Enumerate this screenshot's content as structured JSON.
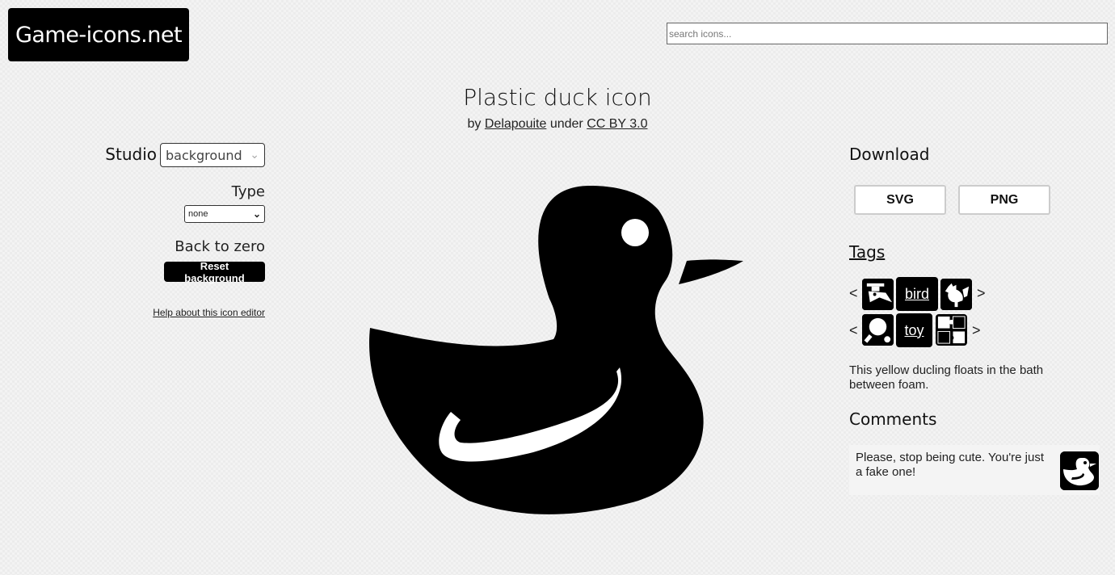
{
  "header": {
    "logo_text": "Game-icons.net",
    "search_placeholder": "search icons..."
  },
  "icon": {
    "title": "Plastic duck icon",
    "by": "by",
    "author": "Delapouite",
    "under": "under",
    "license": "CC BY 3.0"
  },
  "studio": {
    "label": "Studio",
    "background_value": "background",
    "type_label": "Type",
    "type_value": "none",
    "back_to_zero_label": "Back to zero",
    "reset_label": "Reset background",
    "help_link": "Help about this icon editor"
  },
  "download": {
    "heading": "Download",
    "svg_label": "SVG",
    "png_label": "PNG"
  },
  "tags": {
    "heading": "Tags",
    "prev": "<",
    "next": ">",
    "rows": [
      {
        "label": "bird",
        "prev_icon": "plague-doctor-icon",
        "next_icon": "rooster-icon"
      },
      {
        "label": "toy",
        "prev_icon": "ping-pong-bat-icon",
        "next_icon": "jigsaw-piece-icon"
      }
    ]
  },
  "description": "This yellow ducling floats in the bath between foam.",
  "comments": {
    "heading": "Comments",
    "items": [
      {
        "text": "Please, stop being cute. You're just a fake one!",
        "avatar_icon": "duck-icon"
      }
    ]
  },
  "colors": {
    "icon_fg": "#000000",
    "icon_bg": "#ffffff",
    "page_bg": "#ececec"
  }
}
